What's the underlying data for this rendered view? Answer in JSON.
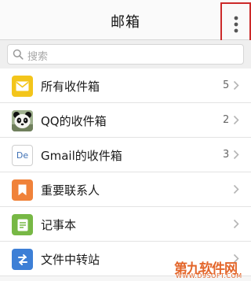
{
  "header": {
    "title": "邮箱"
  },
  "search": {
    "placeholder": "搜索"
  },
  "mailboxes": [
    {
      "label": "所有收件箱",
      "count": "5",
      "icon": "envelope-icon"
    },
    {
      "label": "QQ的收件箱",
      "count": "2",
      "icon": "panda-avatar-icon"
    },
    {
      "label": "Gmail的收件箱",
      "count": "3",
      "icon": "de-badge-icon",
      "badge": "De"
    },
    {
      "label": "重要联系人",
      "count": "",
      "icon": "bookmark-icon"
    },
    {
      "label": "记事本",
      "count": "",
      "icon": "notepad-icon"
    },
    {
      "label": "文件中转站",
      "count": "",
      "icon": "transfer-icon"
    }
  ],
  "watermark": {
    "brand": "第九软件网",
    "url": "WWW.D9SOFT.COM"
  },
  "colors": {
    "accent_red": "#cc2a2a",
    "yellow": "#f3c51b",
    "orange": "#f0823a",
    "green": "#77b845",
    "blue": "#3d7fd6"
  }
}
